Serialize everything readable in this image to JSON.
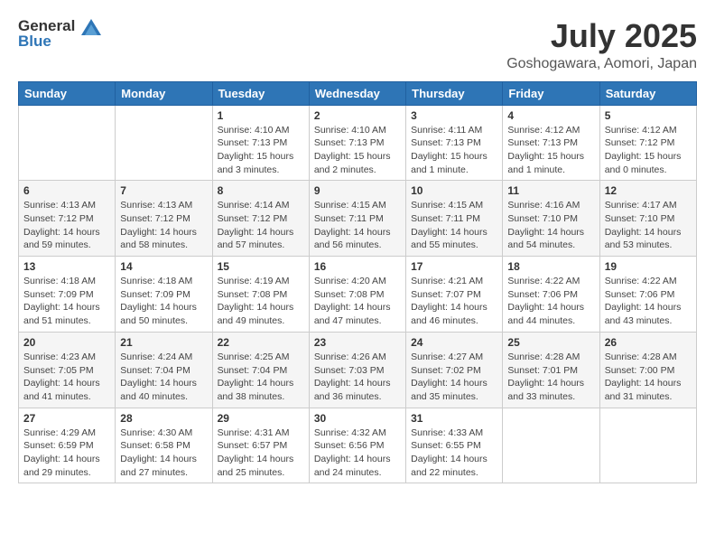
{
  "header": {
    "logo_general": "General",
    "logo_blue": "Blue",
    "month": "July 2025",
    "location": "Goshogawara, Aomori, Japan"
  },
  "weekdays": [
    "Sunday",
    "Monday",
    "Tuesday",
    "Wednesday",
    "Thursday",
    "Friday",
    "Saturday"
  ],
  "weeks": [
    [
      {
        "day": "",
        "details": ""
      },
      {
        "day": "",
        "details": ""
      },
      {
        "day": "1",
        "details": "Sunrise: 4:10 AM\nSunset: 7:13 PM\nDaylight: 15 hours\nand 3 minutes."
      },
      {
        "day": "2",
        "details": "Sunrise: 4:10 AM\nSunset: 7:13 PM\nDaylight: 15 hours\nand 2 minutes."
      },
      {
        "day": "3",
        "details": "Sunrise: 4:11 AM\nSunset: 7:13 PM\nDaylight: 15 hours\nand 1 minute."
      },
      {
        "day": "4",
        "details": "Sunrise: 4:12 AM\nSunset: 7:13 PM\nDaylight: 15 hours\nand 1 minute."
      },
      {
        "day": "5",
        "details": "Sunrise: 4:12 AM\nSunset: 7:12 PM\nDaylight: 15 hours\nand 0 minutes."
      }
    ],
    [
      {
        "day": "6",
        "details": "Sunrise: 4:13 AM\nSunset: 7:12 PM\nDaylight: 14 hours\nand 59 minutes."
      },
      {
        "day": "7",
        "details": "Sunrise: 4:13 AM\nSunset: 7:12 PM\nDaylight: 14 hours\nand 58 minutes."
      },
      {
        "day": "8",
        "details": "Sunrise: 4:14 AM\nSunset: 7:12 PM\nDaylight: 14 hours\nand 57 minutes."
      },
      {
        "day": "9",
        "details": "Sunrise: 4:15 AM\nSunset: 7:11 PM\nDaylight: 14 hours\nand 56 minutes."
      },
      {
        "day": "10",
        "details": "Sunrise: 4:15 AM\nSunset: 7:11 PM\nDaylight: 14 hours\nand 55 minutes."
      },
      {
        "day": "11",
        "details": "Sunrise: 4:16 AM\nSunset: 7:10 PM\nDaylight: 14 hours\nand 54 minutes."
      },
      {
        "day": "12",
        "details": "Sunrise: 4:17 AM\nSunset: 7:10 PM\nDaylight: 14 hours\nand 53 minutes."
      }
    ],
    [
      {
        "day": "13",
        "details": "Sunrise: 4:18 AM\nSunset: 7:09 PM\nDaylight: 14 hours\nand 51 minutes."
      },
      {
        "day": "14",
        "details": "Sunrise: 4:18 AM\nSunset: 7:09 PM\nDaylight: 14 hours\nand 50 minutes."
      },
      {
        "day": "15",
        "details": "Sunrise: 4:19 AM\nSunset: 7:08 PM\nDaylight: 14 hours\nand 49 minutes."
      },
      {
        "day": "16",
        "details": "Sunrise: 4:20 AM\nSunset: 7:08 PM\nDaylight: 14 hours\nand 47 minutes."
      },
      {
        "day": "17",
        "details": "Sunrise: 4:21 AM\nSunset: 7:07 PM\nDaylight: 14 hours\nand 46 minutes."
      },
      {
        "day": "18",
        "details": "Sunrise: 4:22 AM\nSunset: 7:06 PM\nDaylight: 14 hours\nand 44 minutes."
      },
      {
        "day": "19",
        "details": "Sunrise: 4:22 AM\nSunset: 7:06 PM\nDaylight: 14 hours\nand 43 minutes."
      }
    ],
    [
      {
        "day": "20",
        "details": "Sunrise: 4:23 AM\nSunset: 7:05 PM\nDaylight: 14 hours\nand 41 minutes."
      },
      {
        "day": "21",
        "details": "Sunrise: 4:24 AM\nSunset: 7:04 PM\nDaylight: 14 hours\nand 40 minutes."
      },
      {
        "day": "22",
        "details": "Sunrise: 4:25 AM\nSunset: 7:04 PM\nDaylight: 14 hours\nand 38 minutes."
      },
      {
        "day": "23",
        "details": "Sunrise: 4:26 AM\nSunset: 7:03 PM\nDaylight: 14 hours\nand 36 minutes."
      },
      {
        "day": "24",
        "details": "Sunrise: 4:27 AM\nSunset: 7:02 PM\nDaylight: 14 hours\nand 35 minutes."
      },
      {
        "day": "25",
        "details": "Sunrise: 4:28 AM\nSunset: 7:01 PM\nDaylight: 14 hours\nand 33 minutes."
      },
      {
        "day": "26",
        "details": "Sunrise: 4:28 AM\nSunset: 7:00 PM\nDaylight: 14 hours\nand 31 minutes."
      }
    ],
    [
      {
        "day": "27",
        "details": "Sunrise: 4:29 AM\nSunset: 6:59 PM\nDaylight: 14 hours\nand 29 minutes."
      },
      {
        "day": "28",
        "details": "Sunrise: 4:30 AM\nSunset: 6:58 PM\nDaylight: 14 hours\nand 27 minutes."
      },
      {
        "day": "29",
        "details": "Sunrise: 4:31 AM\nSunset: 6:57 PM\nDaylight: 14 hours\nand 25 minutes."
      },
      {
        "day": "30",
        "details": "Sunrise: 4:32 AM\nSunset: 6:56 PM\nDaylight: 14 hours\nand 24 minutes."
      },
      {
        "day": "31",
        "details": "Sunrise: 4:33 AM\nSunset: 6:55 PM\nDaylight: 14 hours\nand 22 minutes."
      },
      {
        "day": "",
        "details": ""
      },
      {
        "day": "",
        "details": ""
      }
    ]
  ]
}
